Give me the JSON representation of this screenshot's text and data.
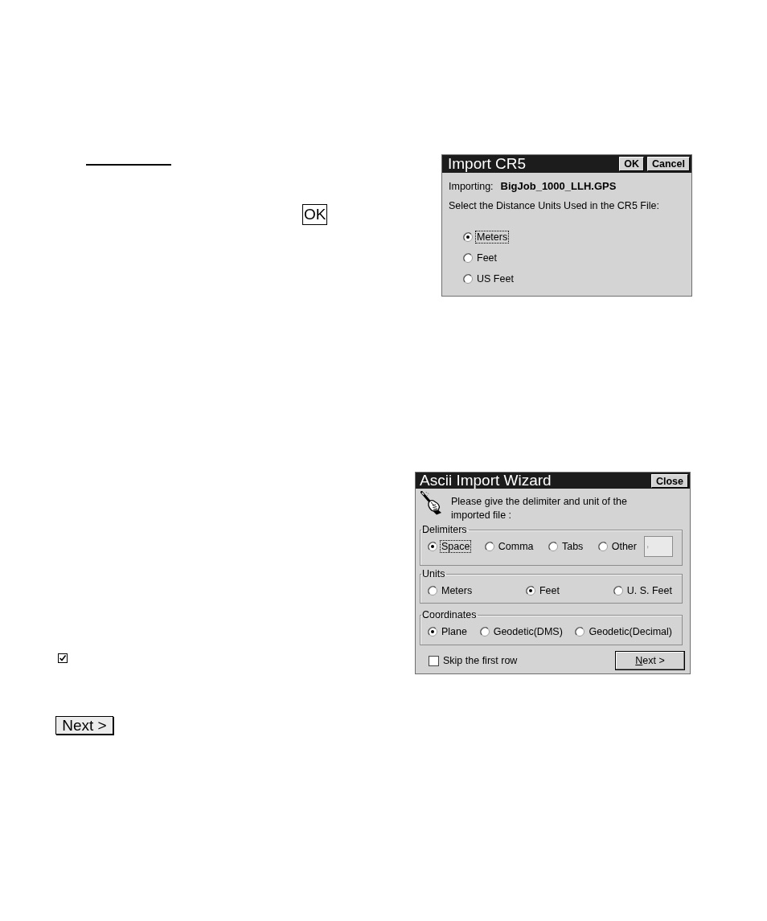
{
  "ok_key": {
    "label": "OK"
  },
  "import_cr5_dialog": {
    "title": "Import CR5",
    "title_buttons": [
      "OK",
      "Cancel"
    ],
    "importing_label": "Importing:",
    "file_name": "BigJob_1000_LLH.GPS",
    "prompt": "Select the Distance Units Used in the CR5 File:",
    "units": [
      {
        "label": "Meters",
        "selected": true,
        "focused": true
      },
      {
        "label": "Feet",
        "selected": false,
        "focused": false
      },
      {
        "label": "US Feet",
        "selected": false,
        "focused": false
      }
    ]
  },
  "ascii_import_wizard": {
    "title": "Ascii Import Wizard",
    "close_button": "Close",
    "instruction": "Please give the delimiter and unit of the imported file :",
    "groups": [
      {
        "title": "Delimiters",
        "options": [
          {
            "label": "Space",
            "selected": true,
            "focused": true
          },
          {
            "label": "Comma",
            "selected": false,
            "focused": false
          },
          {
            "label": "Tabs",
            "selected": false,
            "focused": false
          },
          {
            "label": "Other",
            "selected": false,
            "focused": false
          }
        ],
        "other_field": {
          "value": ",",
          "disabled": true
        }
      },
      {
        "title": "Units",
        "options": [
          {
            "label": "Meters",
            "selected": false,
            "focused": false
          },
          {
            "label": "Feet",
            "selected": true,
            "focused": false
          },
          {
            "label": "U. S. Feet",
            "selected": false,
            "focused": false
          }
        ]
      },
      {
        "title": "Coordinates",
        "options": [
          {
            "label": "Plane",
            "selected": true,
            "focused": false
          },
          {
            "label": "Geodetic(DMS)",
            "selected": false,
            "focused": false
          },
          {
            "label": "Geodetic(Decimal)",
            "selected": false,
            "focused": false
          }
        ]
      }
    ],
    "skip_first_row": {
      "label": "Skip the first row",
      "checked": false
    },
    "next_button": {
      "label": "Next >"
    }
  },
  "checkbox_key": {
    "checked": true
  },
  "next_key": {
    "label": "Next >"
  }
}
